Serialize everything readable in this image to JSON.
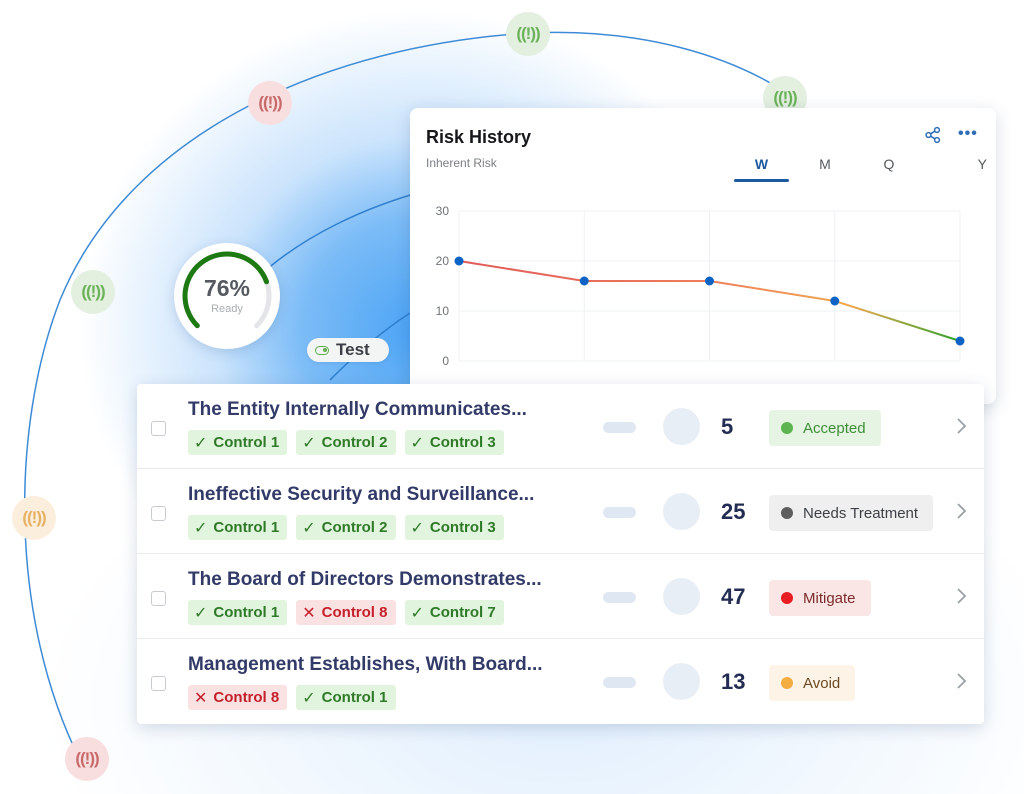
{
  "readiness": {
    "value": "76%",
    "percent": 76,
    "label": "Ready"
  },
  "test_badge": {
    "label": "Test",
    "toggle_on": true
  },
  "alert_nodes": [
    {
      "status": "green",
      "icon": "alarm-alert-icon"
    },
    {
      "status": "red",
      "icon": "alarm-alert-icon"
    },
    {
      "status": "green",
      "icon": "alarm-alert-icon"
    },
    {
      "status": "green",
      "icon": "alarm-alert-icon"
    },
    {
      "status": "orange",
      "icon": "alarm-alert-icon"
    },
    {
      "status": "red",
      "icon": "alarm-alert-icon"
    }
  ],
  "risk_history": {
    "title": "Risk History",
    "subtitle": "Inherent Risk",
    "icons": {
      "share": "share-icon",
      "more": "more-horizontal-icon"
    },
    "tabs": [
      {
        "label": "W",
        "active": true
      },
      {
        "label": "M",
        "active": false
      },
      {
        "label": "Q",
        "active": false
      },
      {
        "label": "Y",
        "active": false
      }
    ],
    "accent_color": "#1e5aa0"
  },
  "chart_data": {
    "type": "line",
    "title": "Risk History",
    "subtitle": "Inherent Risk",
    "x": [
      1,
      2,
      3,
      4,
      5
    ],
    "values": [
      20,
      16,
      16,
      12,
      4
    ],
    "yticks": [
      0,
      10,
      20,
      30
    ],
    "ylim": [
      0,
      30
    ],
    "xlabel": "",
    "ylabel": "",
    "grid": true,
    "legend": "none",
    "line_gradient": [
      "#e05a5a",
      "#f0a050",
      "#3aa82e"
    ],
    "point_color": "#0d63c4"
  },
  "risks": [
    {
      "title": "The Entity Internally Communicates...",
      "controls": [
        {
          "label": "Control 1",
          "passed": true
        },
        {
          "label": "Control 2",
          "passed": true
        },
        {
          "label": "Control 3",
          "passed": true
        }
      ],
      "score": "5",
      "status": "Accepted",
      "status_kind": "accepted"
    },
    {
      "title": "Ineffective Security and Surveillance...",
      "controls": [
        {
          "label": "Control 1",
          "passed": true
        },
        {
          "label": "Control 2",
          "passed": true
        },
        {
          "label": "Control 3",
          "passed": true
        }
      ],
      "score": "25",
      "status": "Needs Treatment",
      "status_kind": "needs"
    },
    {
      "title": "The Board of Directors Demonstrates...",
      "controls": [
        {
          "label": "Control 1",
          "passed": true
        },
        {
          "label": "Control 8",
          "passed": false
        },
        {
          "label": "Control 7",
          "passed": true
        }
      ],
      "score": "47",
      "status": "Mitigate",
      "status_kind": "mitigate"
    },
    {
      "title": "Management Establishes, With Board...",
      "controls": [
        {
          "label": "Control 8",
          "passed": false
        },
        {
          "label": "Control 1",
          "passed": true
        }
      ],
      "score": "13",
      "status": "Avoid",
      "status_kind": "avoid"
    }
  ],
  "glyphs": {
    "check": "✓",
    "cross": "✕",
    "alert": "((!))"
  }
}
